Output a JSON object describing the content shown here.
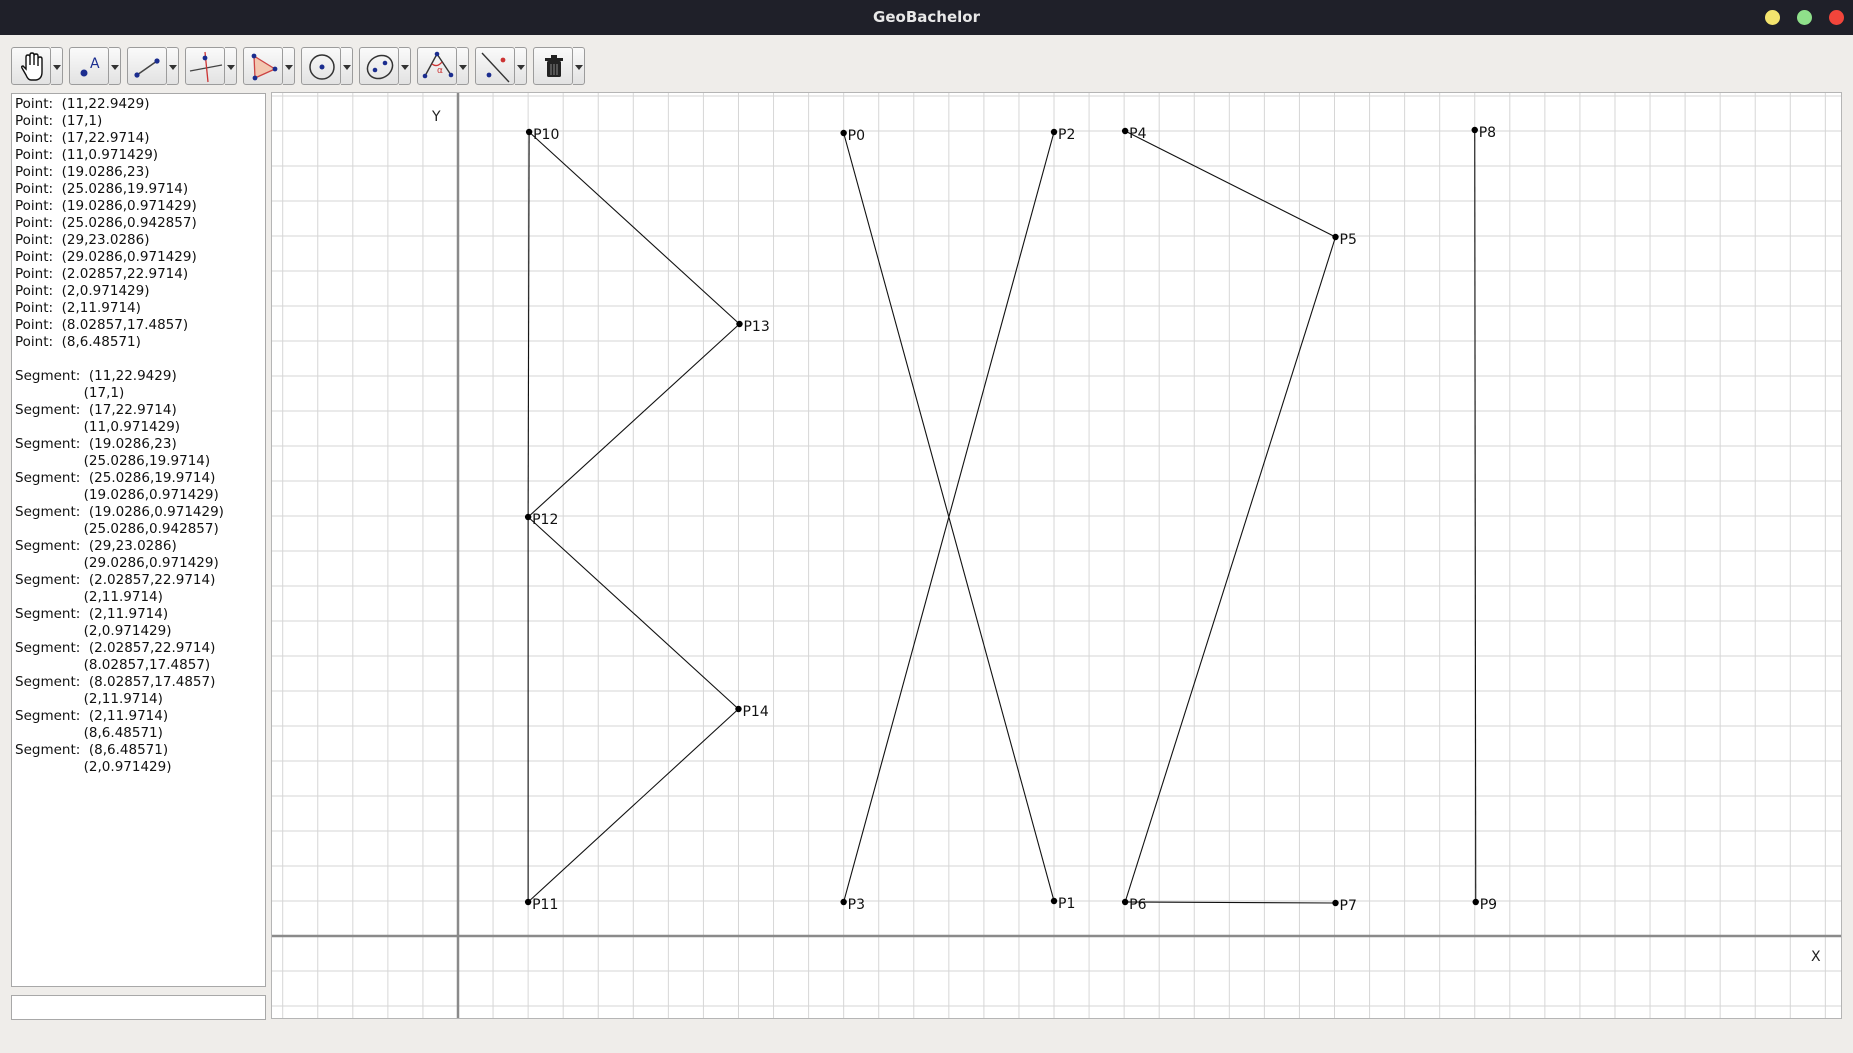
{
  "window": {
    "title": "GeoBachelor",
    "buttons": [
      {
        "name": "minimize-button",
        "color": "#f4e46e"
      },
      {
        "name": "maximize-button",
        "color": "#8fe08a"
      },
      {
        "name": "close-button",
        "color": "#f2453b"
      }
    ]
  },
  "toolbar": {
    "tools": [
      {
        "name": "move-tool",
        "icon": "hand-icon"
      },
      {
        "name": "point-tool",
        "icon": "point-label-icon",
        "glyph": "A"
      },
      {
        "name": "segment-tool",
        "icon": "segment-icon"
      },
      {
        "name": "perpendicular-tool",
        "icon": "perpendicular-icon"
      },
      {
        "name": "polygon-tool",
        "icon": "polygon-icon"
      },
      {
        "name": "circle-tool",
        "icon": "circle-icon"
      },
      {
        "name": "ellipse-tool",
        "icon": "ellipse-icon"
      },
      {
        "name": "angle-tool",
        "icon": "angle-icon",
        "glyph": "α"
      },
      {
        "name": "reflect-tool",
        "icon": "reflect-icon"
      },
      {
        "name": "delete-tool",
        "icon": "trash-icon"
      }
    ]
  },
  "algebra": {
    "lines": [
      "Point:  (11,22.9429)",
      "Point:  (17,1)",
      "Point:  (17,22.9714)",
      "Point:  (11,0.971429)",
      "Point:  (19.0286,23)",
      "Point:  (25.0286,19.9714)",
      "Point:  (19.0286,0.971429)",
      "Point:  (25.0286,0.942857)",
      "Point:  (29,23.0286)",
      "Point:  (29.0286,0.971429)",
      "Point:  (2.02857,22.9714)",
      "Point:  (2,0.971429)",
      "Point:  (2,11.9714)",
      "Point:  (8.02857,17.4857)",
      "Point:  (8,6.48571)",
      "",
      "Segment:  (11,22.9429)",
      "                (17,1)",
      "Segment:  (17,22.9714)",
      "                (11,0.971429)",
      "Segment:  (19.0286,23)",
      "                (25.0286,19.9714)",
      "Segment:  (25.0286,19.9714)",
      "                (19.0286,0.971429)",
      "Segment:  (19.0286,0.971429)",
      "                (25.0286,0.942857)",
      "Segment:  (29,23.0286)",
      "                (29.0286,0.971429)",
      "Segment:  (2.02857,22.9714)",
      "                (2,11.9714)",
      "Segment:  (2,11.9714)",
      "                (2,0.971429)",
      "Segment:  (2.02857,22.9714)",
      "                (8.02857,17.4857)",
      "Segment:  (8.02857,17.4857)",
      "                (2,11.9714)",
      "Segment:  (2,11.9714)",
      "                (8,6.48571)",
      "Segment:  (8,6.48571)",
      "                (2,0.971429)"
    ],
    "input_value": ""
  },
  "graph": {
    "x_axis_label": "X",
    "y_axis_label": "Y",
    "points": [
      {
        "label": "P0",
        "x": 11,
        "y": 22.9429
      },
      {
        "label": "P1",
        "x": 17,
        "y": 1
      },
      {
        "label": "P2",
        "x": 17,
        "y": 22.9714
      },
      {
        "label": "P3",
        "x": 11,
        "y": 0.971429
      },
      {
        "label": "P4",
        "x": 19.0286,
        "y": 23
      },
      {
        "label": "P5",
        "x": 25.0286,
        "y": 19.9714
      },
      {
        "label": "P6",
        "x": 19.0286,
        "y": 0.971429
      },
      {
        "label": "P7",
        "x": 25.0286,
        "y": 0.942857
      },
      {
        "label": "P8",
        "x": 29,
        "y": 23.0286
      },
      {
        "label": "P9",
        "x": 29.0286,
        "y": 0.971429
      },
      {
        "label": "P10",
        "x": 2.02857,
        "y": 22.9714
      },
      {
        "label": "P11",
        "x": 2,
        "y": 0.971429
      },
      {
        "label": "P12",
        "x": 2,
        "y": 11.9714
      },
      {
        "label": "P13",
        "x": 8.02857,
        "y": 17.4857
      },
      {
        "label": "P14",
        "x": 8,
        "y": 6.48571
      }
    ],
    "segments": [
      [
        "P0",
        "P1"
      ],
      [
        "P2",
        "P3"
      ],
      [
        "P4",
        "P5"
      ],
      [
        "P5",
        "P6"
      ],
      [
        "P6",
        "P7"
      ],
      [
        "P8",
        "P9"
      ],
      [
        "P10",
        "P12"
      ],
      [
        "P12",
        "P11"
      ],
      [
        "P10",
        "P13"
      ],
      [
        "P13",
        "P12"
      ],
      [
        "P12",
        "P14"
      ],
      [
        "P14",
        "P11"
      ]
    ]
  }
}
